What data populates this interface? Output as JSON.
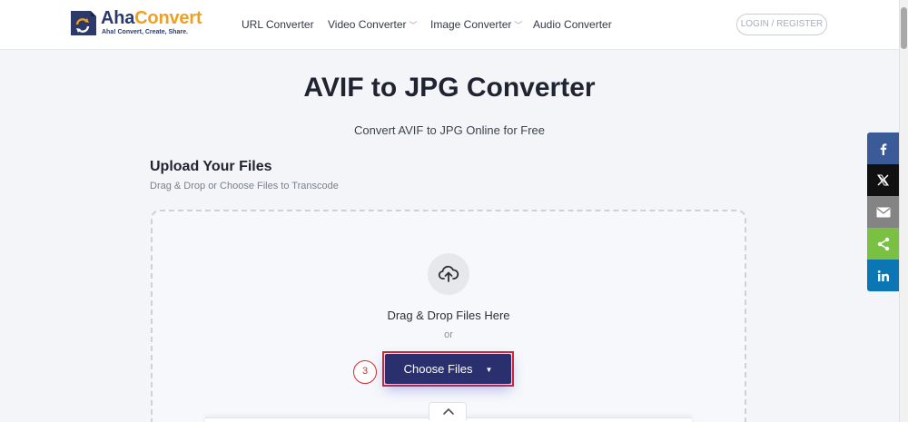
{
  "brand": {
    "name_part1": "Aha",
    "name_part2": "Convert",
    "tagline": "Aha! Convert, Create, Share.",
    "colors": {
      "navy": "#2b3a6b",
      "orange": "#f0a020"
    }
  },
  "nav": {
    "items": [
      {
        "label": "URL Converter",
        "has_dropdown": false
      },
      {
        "label": "Video Converter",
        "has_dropdown": true
      },
      {
        "label": "Image Converter",
        "has_dropdown": true
      },
      {
        "label": "Audio Converter",
        "has_dropdown": false
      }
    ],
    "login_label": "LOGIN / REGISTER"
  },
  "main": {
    "title": "AVIF to JPG Converter",
    "subtitle": "Convert AVIF to JPG Online for Free",
    "upload": {
      "heading": "Upload Your Files",
      "subheading": "Drag & Drop or Choose Files to Transcode",
      "drop_text": "Drag & Drop Files Here",
      "or_text": "or",
      "choose_label": "Choose Files",
      "step_badge": "3",
      "icons": {
        "upload": "cloud-upload-icon",
        "collapse": "chevron-up-icon",
        "dropdown": "caret-down-icon"
      }
    }
  },
  "social": [
    {
      "name": "facebook",
      "icon": "facebook-icon",
      "color": "#3a5a98"
    },
    {
      "name": "x",
      "icon": "x-icon",
      "color": "#111111"
    },
    {
      "name": "email",
      "icon": "mail-icon",
      "color": "#848484"
    },
    {
      "name": "share",
      "icon": "share-icon",
      "color": "#7ac143"
    },
    {
      "name": "linkedin",
      "icon": "linkedin-icon",
      "color": "#0b76b4"
    }
  ],
  "colors": {
    "primary_button": "#2a2f6e",
    "highlight_red": "#e0202a",
    "page_bg": "#f3f5f9"
  }
}
